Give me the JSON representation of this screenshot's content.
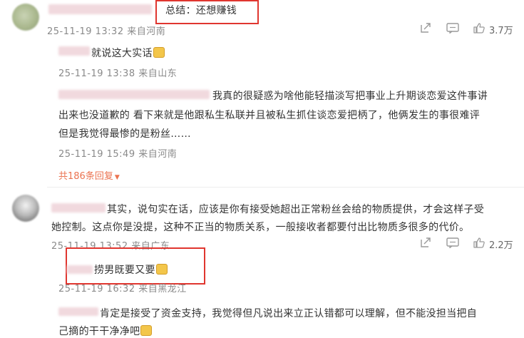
{
  "comments": [
    {
      "text": "总结：还想赚钱",
      "date": "25-11-19 13:32",
      "location": "来自河南",
      "likes": "3.7万",
      "replies": [
        {
          "text": "就说这大实话",
          "date": "25-11-19 13:38",
          "location": "来自山东"
        },
        {
          "line1": "我真的很疑惑为啥他能轻描淡写把事业上升期谈恋爱这件事讲",
          "line2": "出来也没道歉的  看下来就是他跟私生私联并且被私生抓住谈恋爱把柄了，他俩发生的事很难评",
          "line3": "但是我觉得最惨的是粉丝……",
          "date": "25-11-19 15:49",
          "location": "来自河南"
        }
      ],
      "more_replies": "共186条回复"
    },
    {
      "line1": "其实，说句实在话，应该是你有接受她超出正常粉丝会给的物质提供，才会这样子受",
      "line2": "她控制。这点你是没提，这种不正当的物质关系，一般接收者都要付出比物质多很多的代价。",
      "date": "25-11-19 13:52",
      "location": "来自广东",
      "likes": "2.2万",
      "replies": [
        {
          "text": "捞男既要又要",
          "date": "25-11-19 16:32",
          "location": "来自黑龙江"
        },
        {
          "line1": "肯定是接受了资金支持，我觉得但凡说出来立正认错都可以理解，但不能没担当把自",
          "line2": "己摘的干干净净吧"
        }
      ]
    }
  ],
  "colors": {
    "highlight_box": "#e0362f",
    "more_link": "#eb7350"
  },
  "icons": [
    "share-icon",
    "comment-icon",
    "like-icon"
  ]
}
